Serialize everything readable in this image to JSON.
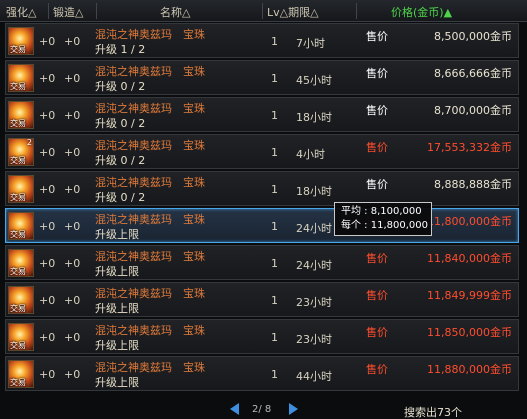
{
  "header": {
    "enhance": "强化△",
    "forge": "锻造△",
    "name": "名称△",
    "level_term": "Lv△期限△",
    "price": "价格(金币)▲"
  },
  "rows": [
    {
      "enhance": "+0",
      "forge": "+0",
      "name": "混沌之神奥兹玛　宝珠",
      "upgrade": "升级 1 / 2",
      "level": "1",
      "term": "7小时",
      "price_label": "售价",
      "price": "8,500,000金币",
      "red": false,
      "stack": ""
    },
    {
      "enhance": "+0",
      "forge": "+0",
      "name": "混沌之神奥兹玛　宝珠",
      "upgrade": "升级 0 / 2",
      "level": "1",
      "term": "45小时",
      "price_label": "售价",
      "price": "8,666,666金币",
      "red": false,
      "stack": ""
    },
    {
      "enhance": "+0",
      "forge": "+0",
      "name": "混沌之神奥兹玛　宝珠",
      "upgrade": "升级 0 / 2",
      "level": "1",
      "term": "18小时",
      "price_label": "售价",
      "price": "8,700,000金币",
      "red": false,
      "stack": ""
    },
    {
      "enhance": "+0",
      "forge": "+0",
      "name": "混沌之神奥兹玛　宝珠",
      "upgrade": "升级 0 / 2",
      "level": "1",
      "term": "4小时",
      "price_label": "售价",
      "price": "17,553,332金币",
      "red": true,
      "stack": "2"
    },
    {
      "enhance": "+0",
      "forge": "+0",
      "name": "混沌之神奥兹玛　宝珠",
      "upgrade": "升级 0 / 2",
      "level": "1",
      "term": "18小时",
      "price_label": "售价",
      "price": "8,888,888金币",
      "red": false,
      "stack": ""
    },
    {
      "enhance": "+0",
      "forge": "+0",
      "name": "混沌之神奥兹玛　宝珠",
      "upgrade": "升级上限",
      "level": "1",
      "term": "24小时",
      "price_label": "售价",
      "price": "11,800,000金币",
      "red": true,
      "stack": ""
    },
    {
      "enhance": "+0",
      "forge": "+0",
      "name": "混沌之神奥兹玛　宝珠",
      "upgrade": "升级上限",
      "level": "1",
      "term": "24小时",
      "price_label": "售价",
      "price": "11,840,000金币",
      "red": true,
      "stack": ""
    },
    {
      "enhance": "+0",
      "forge": "+0",
      "name": "混沌之神奥兹玛　宝珠",
      "upgrade": "升级上限",
      "level": "1",
      "term": "23小时",
      "price_label": "售价",
      "price": "11,849,999金币",
      "red": true,
      "stack": ""
    },
    {
      "enhance": "+0",
      "forge": "+0",
      "name": "混沌之神奥兹玛　宝珠",
      "upgrade": "升级上限",
      "level": "1",
      "term": "23小时",
      "price_label": "售价",
      "price": "11,850,000金币",
      "red": true,
      "stack": ""
    },
    {
      "enhance": "+0",
      "forge": "+0",
      "name": "混沌之神奥兹玛　宝珠",
      "upgrade": "升级上限",
      "level": "1",
      "term": "44小时",
      "price_label": "售价",
      "price": "11,880,000金币",
      "red": true,
      "stack": ""
    }
  ],
  "item_icon_label": "交易",
  "selected_row": 5,
  "tooltip": {
    "average": "平均 : 8,100,000",
    "each": "每个 : 11,800,000"
  },
  "pagination": {
    "page": "2/ 8"
  },
  "search_count": "搜索出73个",
  "colors": {
    "accent_blue": "#3f8fe0",
    "price_red": "#ff4d2e",
    "name_orange": "#e07a3a",
    "sort_active": "#4ed34a"
  }
}
